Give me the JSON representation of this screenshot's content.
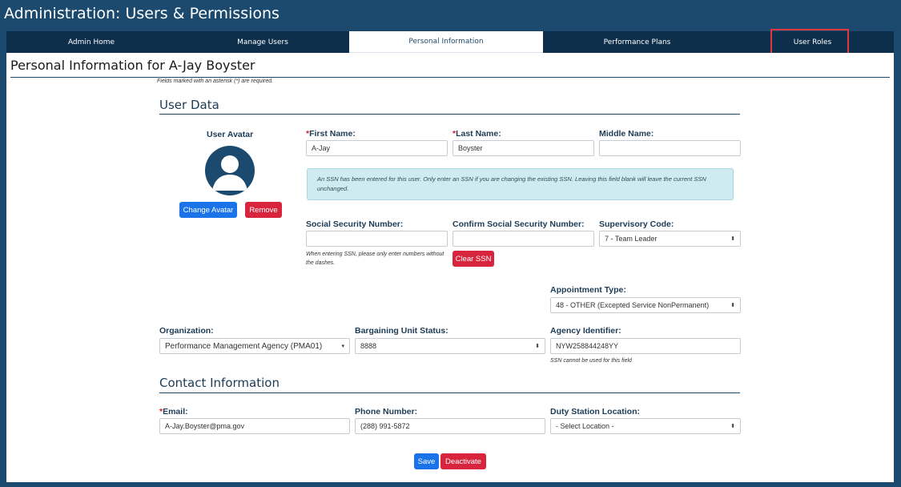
{
  "app": {
    "title": "Administration: Users & Permissions"
  },
  "tabs": [
    {
      "label": "Admin Home"
    },
    {
      "label": "Manage Users"
    },
    {
      "label": "Personal Information",
      "active": true
    },
    {
      "label": "Performance Plans"
    },
    {
      "label": "User Roles"
    }
  ],
  "page": {
    "title": "Personal Information for A-Jay Boyster",
    "required_note": "Fields marked with an asterisk (*) are required."
  },
  "user_data": {
    "heading": "User Data",
    "avatar_label": "User Avatar",
    "change_avatar": "Change Avatar",
    "remove": "Remove",
    "first_name": {
      "label": "First Name:",
      "value": "A-Jay",
      "required": "*"
    },
    "last_name": {
      "label": "Last Name:",
      "value": "Boyster",
      "required": "*"
    },
    "middle_name": {
      "label": "Middle Name:",
      "value": ""
    },
    "ssn_alert": "An SSN has been entered for this user. Only enter an SSN if you are changing the existing SSN. Leaving this field blank will leave the current SSN unchanged.",
    "ssn": {
      "label": "Social Security Number:",
      "value": "",
      "hint": "When entering SSN, please only enter numbers without the dashes."
    },
    "confirm_ssn": {
      "label": "Confirm Social Security Number:",
      "value": ""
    },
    "clear_ssn": "Clear SSN",
    "supervisory_code": {
      "label": "Supervisory Code:",
      "value": "7 - Team Leader"
    },
    "appointment_type": {
      "label": "Appointment Type:",
      "value": "48 - OTHER (Excepted Service NonPermanent)"
    },
    "organization": {
      "label": "Organization:",
      "value": "Performance Management Agency (PMA01)"
    },
    "bargaining_unit": {
      "label": "Bargaining Unit Status:",
      "value": "8888"
    },
    "agency_identifier": {
      "label": "Agency Identifier:",
      "value": "NYW258844248YY",
      "hint": "SSN cannot be used for this field"
    }
  },
  "contact": {
    "heading": "Contact Information",
    "email": {
      "label": "Email:",
      "value": "A-Jay.Boyster@pma.gov",
      "required": "*"
    },
    "phone": {
      "label": "Phone Number:",
      "value": "(288) 991-5872"
    },
    "duty_station": {
      "label": "Duty Station Location:",
      "value": "- Select Location -"
    }
  },
  "actions": {
    "save": "Save",
    "deactivate": "Deactivate"
  },
  "colors": {
    "header_bg": "#1b4a6e",
    "tab_bar": "#0d2f4b",
    "primary": "#1a73e8",
    "danger": "#d9243d",
    "highlight": "#e0383c"
  }
}
